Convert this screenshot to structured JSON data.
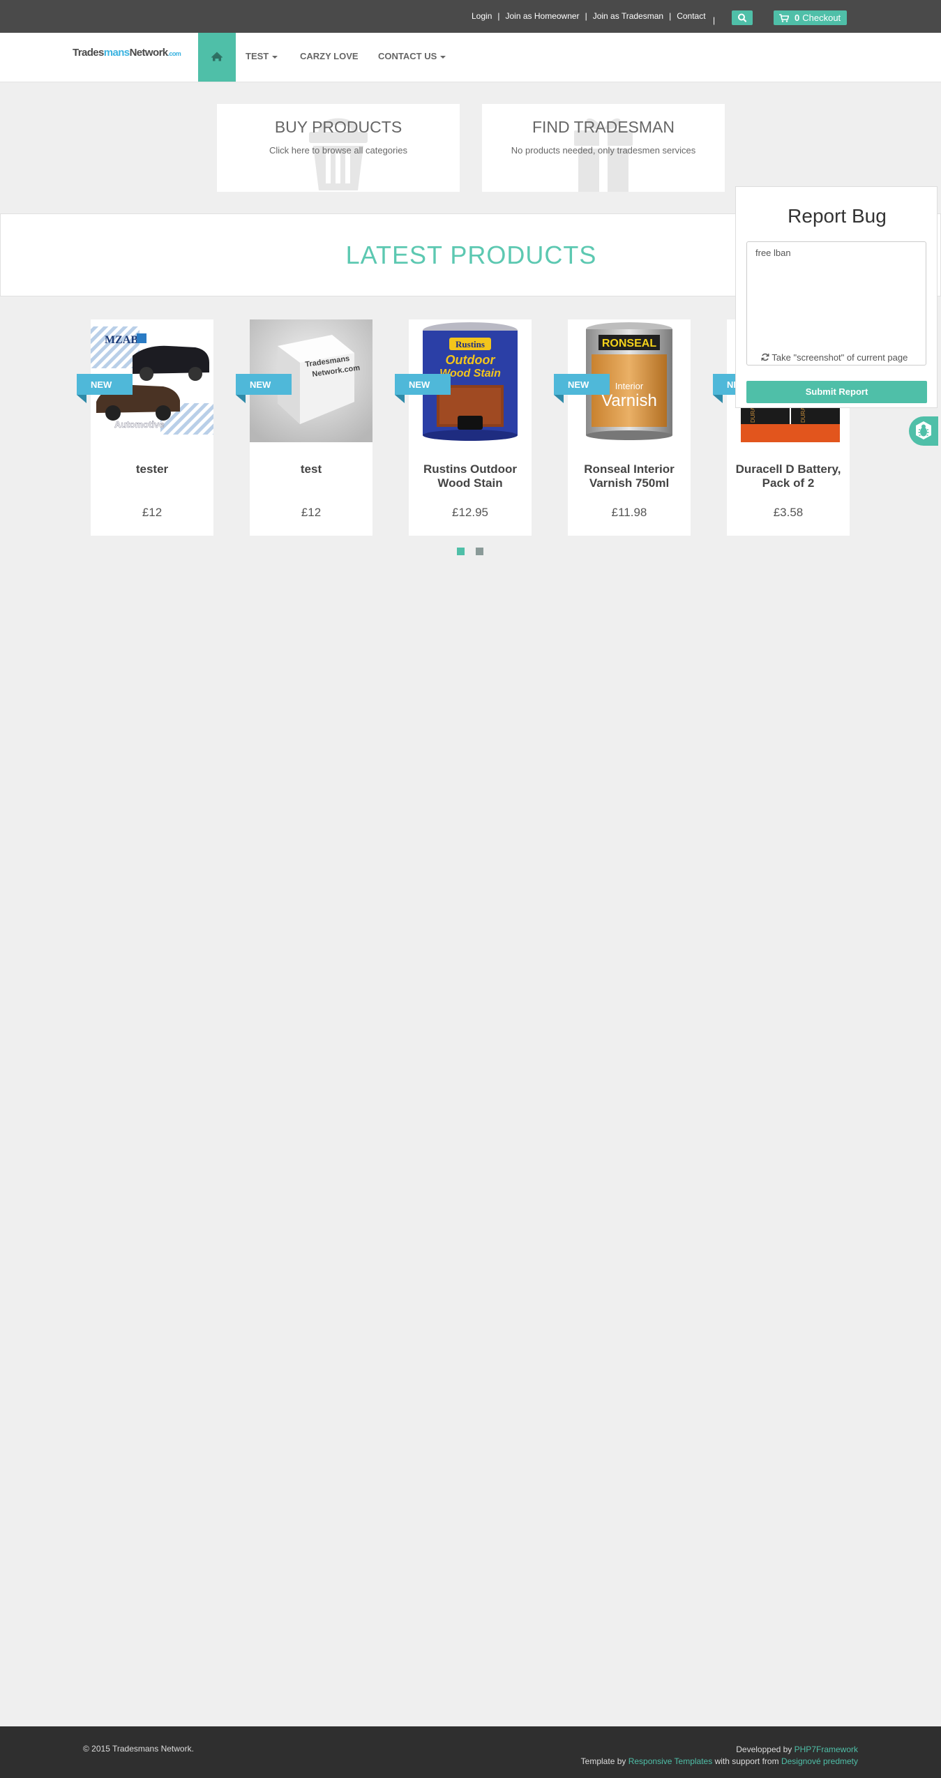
{
  "topbar": {
    "links": [
      {
        "label": "Login"
      },
      {
        "label": "Join as Homeowner"
      },
      {
        "label": "Join as Tradesman"
      },
      {
        "label": "Contact"
      }
    ],
    "separator": "|",
    "cart_count": "0",
    "checkout_label": "Checkout",
    "icons": [
      "search-icon",
      "cart-icon"
    ]
  },
  "logo": {
    "part1": "Trades",
    "part2": "mans",
    "part3": "Network",
    "part4": ".com"
  },
  "nav": {
    "home_icon": "home-icon",
    "items": [
      {
        "label": "TEST",
        "dropdown": true
      },
      {
        "label": "CARZY LOVE",
        "dropdown": false
      },
      {
        "label": "CONTACT US",
        "dropdown": true
      }
    ]
  },
  "features": [
    {
      "title": "BUY PRODUCTS",
      "subtitle": "Click here to browse all categories",
      "icon": "basket-icon"
    },
    {
      "title": "FIND TRADESMAN",
      "subtitle": "No products needed, only tradesmen services",
      "icon": "gift-icon"
    }
  ],
  "latest": {
    "heading": "LATEST PRODUCTS"
  },
  "products": [
    {
      "badge": "NEW",
      "name": "tester",
      "price": "£12"
    },
    {
      "badge": "NEW",
      "name": "test",
      "price": "£12"
    },
    {
      "badge": "NEW",
      "name": "Rustins Outdoor Wood Stain",
      "price": "£12.95"
    },
    {
      "badge": "NEW",
      "name": "Ronseal Interior Varnish 750ml",
      "price": "£11.98"
    },
    {
      "badge": "NEW",
      "name": "Duracell D Battery, Pack of 2",
      "price": "£3.58"
    }
  ],
  "product_images": {
    "p1": {
      "text": "MZABI",
      "caption": "Automotive"
    },
    "p2": {
      "line1": "Tradesmans",
      "line2": "Network.com"
    },
    "p3": {
      "brand": "Rustins",
      "line1": "Outdoor",
      "line2": "Wood Stain"
    },
    "p4": {
      "brand": "RONSEAL",
      "line1": "Interior",
      "line2": "Varnish"
    },
    "p5": {
      "brand": "DURACELL"
    }
  },
  "carousel": {
    "pages": 2,
    "active": 1
  },
  "report_bug": {
    "title": "Report Bug",
    "textarea_value": "free lban",
    "screenshot_label": "Take \"screenshot\" of current page",
    "submit_label": "Submit Report",
    "tab_icon": "bug-icon"
  },
  "footer": {
    "copyright": "© 2015 Tradesmans Network.",
    "developed_prefix": "Developped by ",
    "developed_link": "PHP7Framework",
    "template_prefix": "Template by ",
    "template_link": "Responsive Templates",
    "support_text": " with support from ",
    "support_link": "Designové predmety"
  },
  "colors": {
    "accent": "#4fbfa8",
    "ribbon": "#4fb8d9",
    "topbar": "#4a4a4a",
    "footer": "#2f2f2f",
    "background": "#efefef"
  }
}
